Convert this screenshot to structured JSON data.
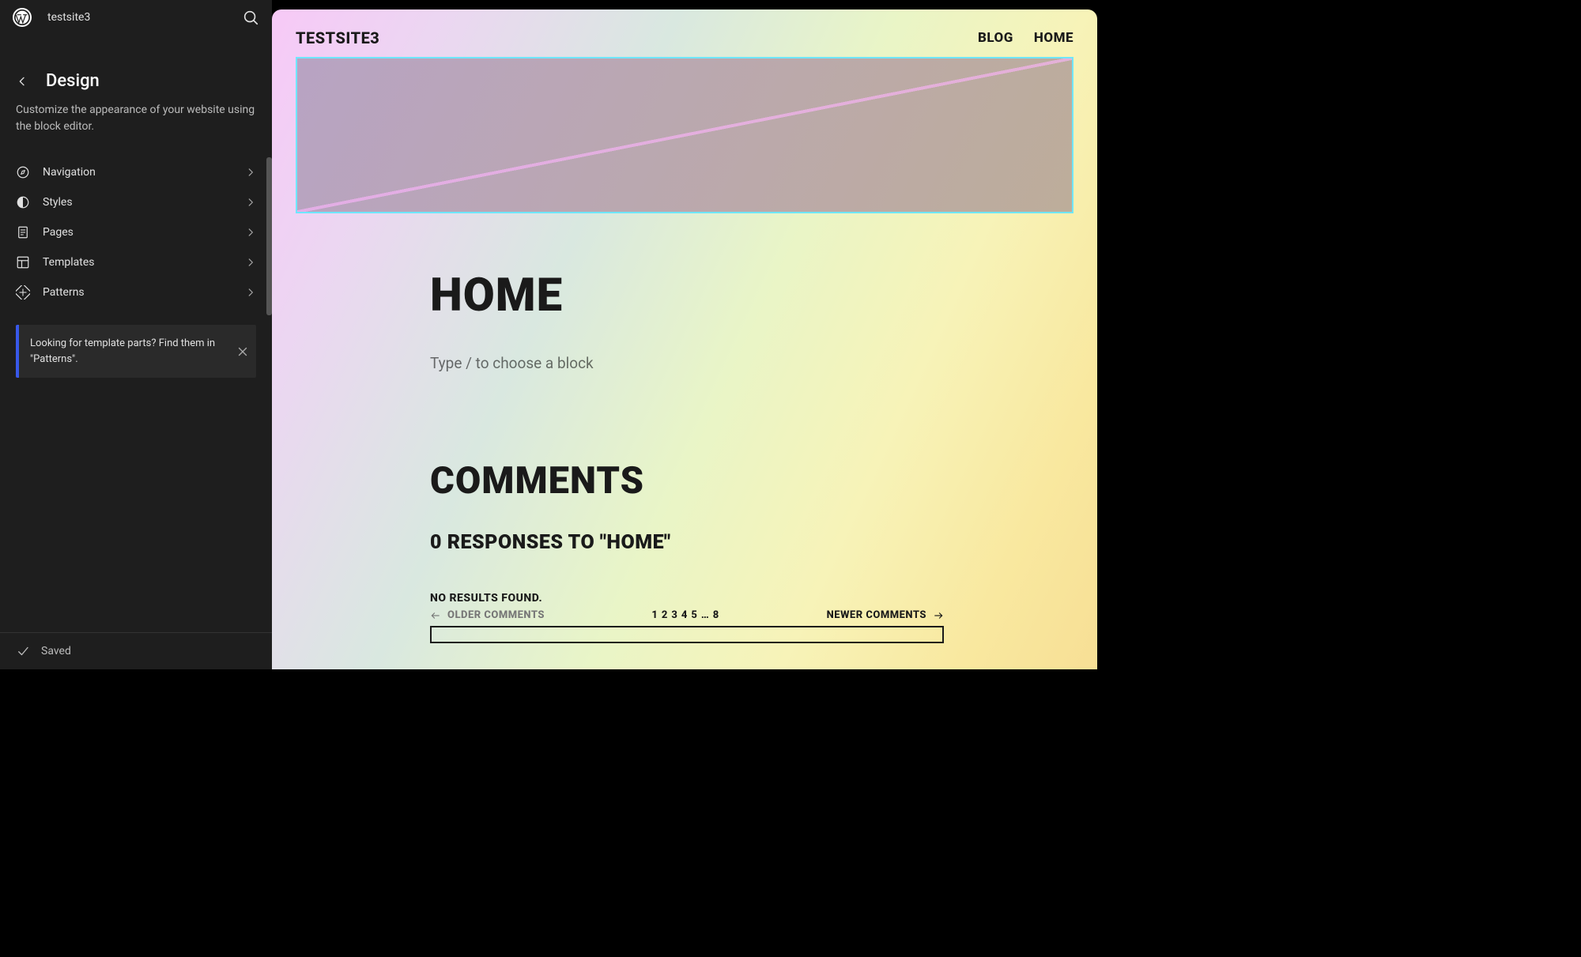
{
  "topbar": {
    "site_name": "testsite3"
  },
  "sidebar": {
    "title": "Design",
    "description": "Customize the appearance of your website using the block editor.",
    "items": [
      {
        "icon": "navigation",
        "label": "Navigation"
      },
      {
        "icon": "styles",
        "label": "Styles"
      },
      {
        "icon": "pages",
        "label": "Pages"
      },
      {
        "icon": "templates",
        "label": "Templates"
      },
      {
        "icon": "patterns",
        "label": "Patterns"
      }
    ],
    "notice": "Looking for template parts? Find them in \"Patterns\".",
    "footer_status": "Saved"
  },
  "preview": {
    "brand": "TESTSITE3",
    "nav": [
      "BLOG",
      "HOME"
    ],
    "page_title": "HOME",
    "block_placeholder": "Type / to choose a block",
    "comments_heading": "COMMENTS",
    "responses_heading": "0 RESPONSES TO \"HOME\"",
    "no_results": "NO RESULTS FOUND.",
    "older_label": "OLDER COMMENTS",
    "newer_label": "NEWER COMMENTS",
    "page_numbers": [
      "1",
      "2",
      "3",
      "4",
      "5",
      "…",
      "8"
    ]
  }
}
